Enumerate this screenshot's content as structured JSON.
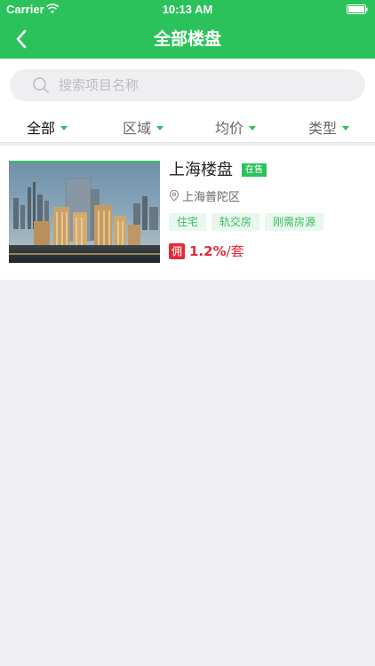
{
  "status_bar": {
    "carrier": "Carrier",
    "time": "10:13 AM"
  },
  "nav": {
    "title": "全部楼盘",
    "back_icon": "chevron-left-icon"
  },
  "search": {
    "placeholder": "搜索项目名称",
    "value": ""
  },
  "filters": [
    {
      "label": "全部",
      "active": true
    },
    {
      "label": "区域",
      "active": false
    },
    {
      "label": "均价",
      "active": false
    },
    {
      "label": "类型",
      "active": false
    }
  ],
  "listings": [
    {
      "name": "上海楼盘",
      "status": "在售",
      "location": "上海普陀区",
      "tags": [
        "住宅",
        "轨交房",
        "刚需房源"
      ],
      "commission_icon": "佣",
      "commission_value": "1.2%",
      "commission_unit": "/套"
    }
  ],
  "colors": {
    "primary": "#2cc25b",
    "tag_bg": "#e9f8ee",
    "tag_text": "#3cbc64",
    "commission": "#e02d3a",
    "background": "#efeff4"
  }
}
